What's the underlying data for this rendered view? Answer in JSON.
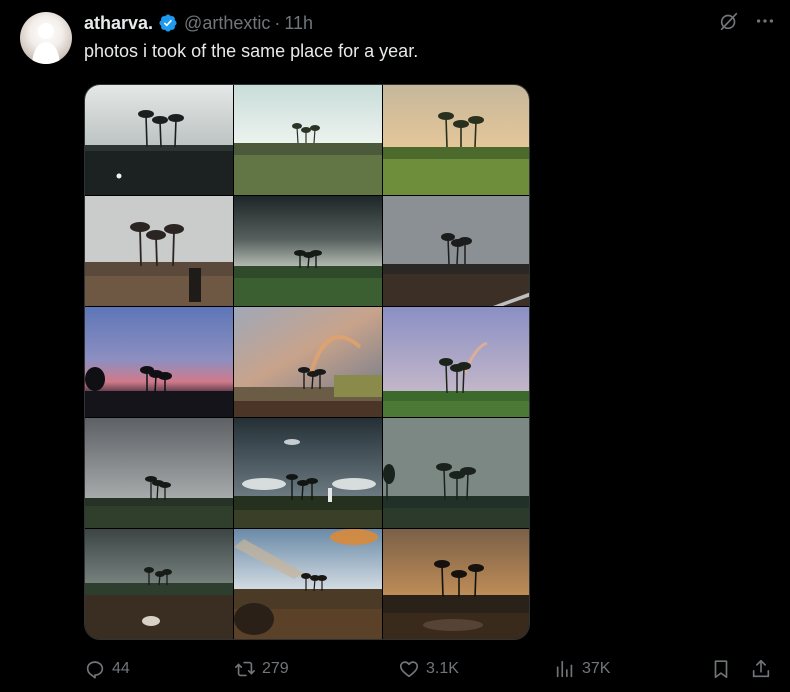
{
  "author": {
    "display_name": "atharva.",
    "handle": "@arthextic",
    "separator": "·",
    "time": "11h",
    "verified": true
  },
  "post": {
    "text": "photos i took of the same place for a year.",
    "photo_count": 15
  },
  "actions": {
    "replies": "44",
    "retweets": "279",
    "likes": "3.1K",
    "views": "37K"
  },
  "icons": {
    "grok": "grok-icon",
    "more": "more-icon",
    "reply": "reply-icon",
    "retweet": "retweet-icon",
    "like": "heart-icon",
    "views": "views-icon",
    "bookmark": "bookmark-icon",
    "share": "share-icon"
  },
  "colors": {
    "background": "#000000",
    "text": "#e7e9ea",
    "secondary": "#71767b",
    "verified": "#1d9bf0"
  }
}
